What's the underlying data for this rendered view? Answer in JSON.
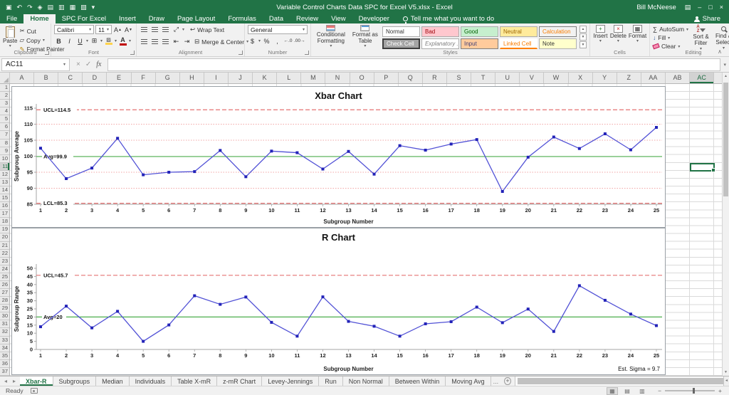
{
  "colors": {
    "excel_green": "#217346",
    "series_line": "#5252d6",
    "series_marker": "#2323b8",
    "limit_line": "#e57373",
    "zone_line": "#f2a6a6",
    "avg_line": "#4cae4c",
    "axis": "#a6a6a6"
  },
  "title_bar": {
    "title": "Variable Control Charts Data SPC for Excel V5.xlsx - Excel",
    "user": "Bill McNeese",
    "share_label": "Share"
  },
  "quick_access": [
    {
      "name": "save-icon",
      "glyph": "▣"
    },
    {
      "name": "undo-icon",
      "glyph": "↶"
    },
    {
      "name": "redo-icon",
      "glyph": "↷"
    },
    {
      "name": "customize-icon",
      "glyph": "◈"
    },
    {
      "name": "new-file-icon",
      "glyph": "▤"
    },
    {
      "name": "export-icon",
      "glyph": "▥"
    },
    {
      "name": "open-icon",
      "glyph": "▦"
    },
    {
      "name": "print-preview-icon",
      "glyph": "▧"
    },
    {
      "name": "qat-more-icon",
      "glyph": "▾"
    }
  ],
  "window_buttons": {
    "ribbon_options": "▤",
    "minimize": "–",
    "restore": "□",
    "close": "×"
  },
  "ribbon_tabs": [
    {
      "label": "File"
    },
    {
      "label": "Home",
      "active": true
    },
    {
      "label": "SPC For Excel"
    },
    {
      "label": "Insert"
    },
    {
      "label": "Draw"
    },
    {
      "label": "Page Layout"
    },
    {
      "label": "Formulas"
    },
    {
      "label": "Data"
    },
    {
      "label": "Review"
    },
    {
      "label": "View"
    },
    {
      "label": "Developer"
    }
  ],
  "tell_me_label": "Tell me what you want to do",
  "ribbon": {
    "clipboard": {
      "group_label": "Clipboard",
      "paste_label": "Paste",
      "cut_label": "Cut",
      "copy_label": "Copy",
      "format_painter_label": "Format Painter"
    },
    "font": {
      "group_label": "Font",
      "font_name": "Calibri",
      "font_size": "11",
      "bold": "B",
      "italic": "I",
      "underline": "U"
    },
    "alignment": {
      "group_label": "Alignment",
      "wrap_text_label": "Wrap Text",
      "merge_center_label": "Merge & Center"
    },
    "number": {
      "group_label": "Number",
      "format_value": "General",
      "currency": "$",
      "percent": "%",
      "comma": ",",
      "increase_decimal": "←.0",
      "decrease_decimal": ".00→"
    },
    "styles": {
      "group_label": "Styles",
      "conditional_label": "Conditional Formatting",
      "format_table_label": "Format as Table",
      "gallery_rows": [
        [
          {
            "label": "Normal",
            "style": "normal"
          },
          {
            "label": "Bad",
            "style": "bad"
          },
          {
            "label": "Good",
            "style": "good"
          },
          {
            "label": "Neutral",
            "style": "neutral"
          },
          {
            "label": "Calculation",
            "style": "calculation"
          }
        ],
        [
          {
            "label": "Check Cell",
            "style": "check"
          },
          {
            "label": "Explanatory ...",
            "style": "explanatory"
          },
          {
            "label": "Input",
            "style": "input"
          },
          {
            "label": "Linked Cell",
            "style": "linked"
          },
          {
            "label": "Note",
            "style": "note"
          }
        ]
      ]
    },
    "cells": {
      "group_label": "Cells",
      "insert_label": "Insert",
      "delete_label": "Delete",
      "format_label": "Format"
    },
    "editing": {
      "group_label": "Editing",
      "autosum_label": "AutoSum",
      "fill_label": "Fill",
      "clear_label": "Clear",
      "sort_label": "Sort & Filter",
      "find_label": "Find & Select"
    }
  },
  "formula_bar": {
    "name_box": "AC11",
    "fx_label": "fx",
    "formula_value": ""
  },
  "grid": {
    "columns": [
      "A",
      "B",
      "C",
      "D",
      "E",
      "F",
      "G",
      "H",
      "I",
      "J",
      "K",
      "L",
      "M",
      "N",
      "O",
      "P",
      "Q",
      "R",
      "S",
      "T",
      "U",
      "V",
      "W",
      "X",
      "Y",
      "Z",
      "AA",
      "AB",
      "AC"
    ],
    "selected_column": "AC",
    "row_count": 37,
    "selected_row": 11,
    "selected_cell": "AC11"
  },
  "sheet_bar": {
    "tabs": [
      {
        "label": "Xbar-R",
        "active": true
      },
      {
        "label": "Subgroups"
      },
      {
        "label": "Median"
      },
      {
        "label": "Individuals"
      },
      {
        "label": "Table X-mR"
      },
      {
        "label": "z-mR Chart"
      },
      {
        "label": "Levey-Jennings"
      },
      {
        "label": "Run"
      },
      {
        "label": "Non Normal"
      },
      {
        "label": "Between Within"
      },
      {
        "label": "Moving Avg"
      }
    ],
    "overflow_label": "...",
    "add_sheet_label": "+"
  },
  "status_bar": {
    "mode": "Ready"
  },
  "chart_data": [
    {
      "type": "line",
      "title": "Xbar Chart",
      "xlabel": "Subgroup Number",
      "ylabel": "Subgroup Average",
      "ylim": [
        85,
        115
      ],
      "ytick_step": 5,
      "grid": false,
      "legend": false,
      "categories": [
        1,
        2,
        3,
        4,
        5,
        6,
        7,
        8,
        9,
        10,
        11,
        12,
        13,
        14,
        15,
        16,
        17,
        18,
        19,
        20,
        21,
        22,
        23,
        24,
        25
      ],
      "values": [
        102.5,
        93,
        96.3,
        105.6,
        94.2,
        95,
        95.2,
        101.8,
        93.6,
        101.6,
        101.1,
        96,
        101.5,
        94.4,
        103.3,
        101.9,
        103.8,
        105.2,
        89,
        99.7,
        106,
        102.4,
        107,
        102,
        109
      ],
      "center_line": {
        "value": 99.9,
        "label": "Avg=99.9"
      },
      "ucl": {
        "value": 114.5,
        "label": "UCL=114.5"
      },
      "lcl": {
        "value": 85.3,
        "label": "LCL=85.3"
      },
      "zone_lines": [
        90,
        95,
        105,
        110
      ],
      "annotation": ""
    },
    {
      "type": "line",
      "title": "R Chart",
      "xlabel": "Subgroup Number",
      "ylabel": "Subgroup Range",
      "ylim": [
        0,
        50
      ],
      "ytick_step": 5,
      "grid": false,
      "legend": false,
      "categories": [
        1,
        2,
        3,
        4,
        5,
        6,
        7,
        8,
        9,
        10,
        11,
        12,
        13,
        14,
        15,
        16,
        17,
        18,
        19,
        20,
        21,
        22,
        23,
        24,
        25
      ],
      "values": [
        14,
        26.7,
        13.3,
        23.5,
        5,
        15.1,
        33.1,
        27.8,
        32.3,
        16.7,
        8.2,
        32.4,
        17.3,
        14.3,
        8.2,
        15.8,
        17.1,
        26.1,
        16.5,
        24.9,
        11.1,
        39.3,
        30.3,
        21.8,
        14.7
      ],
      "center_line": {
        "value": 20,
        "label": "Avg=20"
      },
      "ucl": {
        "value": 45.7,
        "label": "UCL=45.7"
      },
      "zone_lines": [],
      "annotation": "Est. Sigma = 9.7"
    }
  ]
}
